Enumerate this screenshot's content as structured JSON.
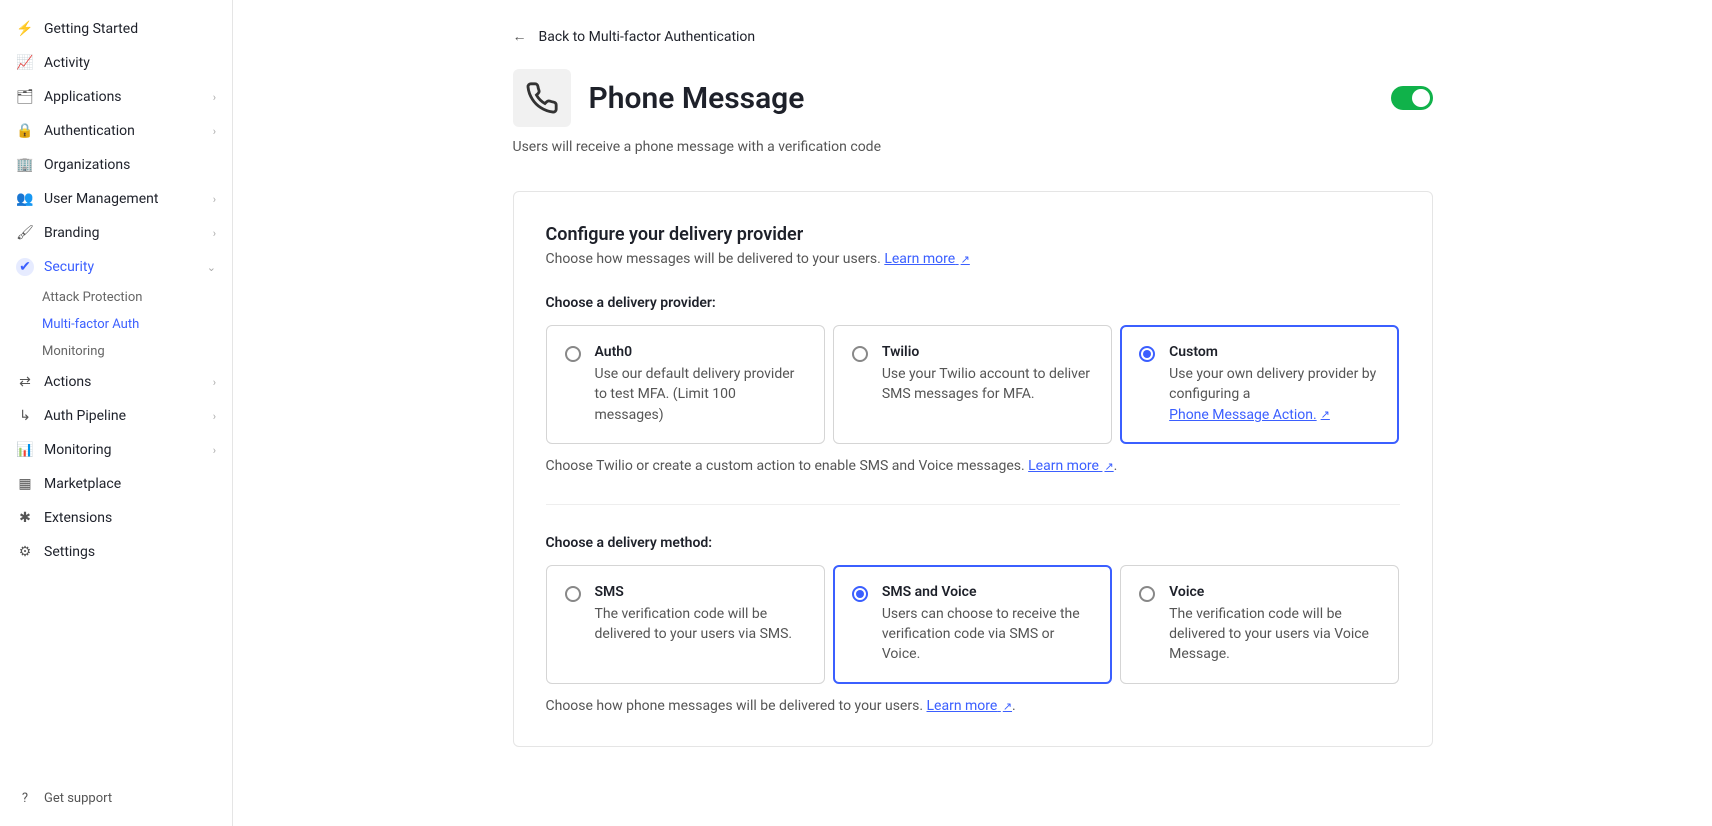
{
  "sidebar": {
    "items": [
      {
        "label": "Getting Started",
        "icon": "⚡",
        "expandable": false
      },
      {
        "label": "Activity",
        "icon": "📈",
        "expandable": false
      },
      {
        "label": "Applications",
        "icon": "🗂",
        "expandable": true
      },
      {
        "label": "Authentication",
        "icon": "🔒",
        "expandable": true
      },
      {
        "label": "Organizations",
        "icon": "🏢",
        "expandable": false
      },
      {
        "label": "User Management",
        "icon": "👥",
        "expandable": true
      },
      {
        "label": "Branding",
        "icon": "🖌",
        "expandable": true
      },
      {
        "label": "Security",
        "icon": "✔",
        "expandable": true,
        "active": true
      },
      {
        "label": "Actions",
        "icon": "⇄",
        "expandable": true
      },
      {
        "label": "Auth Pipeline",
        "icon": "↳",
        "expandable": true
      },
      {
        "label": "Monitoring",
        "icon": "📊",
        "expandable": true
      },
      {
        "label": "Marketplace",
        "icon": "▦",
        "expandable": false
      },
      {
        "label": "Extensions",
        "icon": "✱",
        "expandable": false
      },
      {
        "label": "Settings",
        "icon": "⚙",
        "expandable": false
      }
    ],
    "security_sub": [
      {
        "label": "Attack Protection",
        "active": false
      },
      {
        "label": "Multi-factor Auth",
        "active": true
      },
      {
        "label": "Monitoring",
        "active": false
      }
    ],
    "support_label": "Get support"
  },
  "main": {
    "back_label": "Back to Multi-factor Authentication",
    "title": "Phone Message",
    "subtitle": "Users will receive a phone message with a verification code",
    "toggle_on": true,
    "provider_section": {
      "title": "Configure your delivery provider",
      "desc_prefix": "Choose how messages will be delivered to your users. ",
      "learn_more": "Learn more",
      "field_label": "Choose a delivery provider:",
      "options": [
        {
          "title": "Auth0",
          "desc": "Use our default delivery provider to test MFA. (Limit 100 messages)",
          "selected": false
        },
        {
          "title": "Twilio",
          "desc": "Use your Twilio account to deliver SMS messages for MFA.",
          "selected": false
        },
        {
          "title": "Custom",
          "desc_prefix": "Use your own delivery provider by configuring a ",
          "link_text": "Phone Message Action.",
          "selected": true
        }
      ],
      "footnote_prefix": "Choose Twilio or create a custom action to enable SMS and Voice messages. ",
      "footnote_link": "Learn more",
      "footnote_suffix": "."
    },
    "method_section": {
      "field_label": "Choose a delivery method:",
      "options": [
        {
          "title": "SMS",
          "desc": "The verification code will be delivered to your users via SMS.",
          "selected": false
        },
        {
          "title": "SMS and Voice",
          "desc": "Users can choose to receive the verification code via SMS or Voice.",
          "selected": true
        },
        {
          "title": "Voice",
          "desc": "The verification code will be delivered to your users via Voice Message.",
          "selected": false
        }
      ],
      "footnote_prefix": "Choose how phone messages will be delivered to your users. ",
      "footnote_link": "Learn more",
      "footnote_suffix": "."
    }
  }
}
